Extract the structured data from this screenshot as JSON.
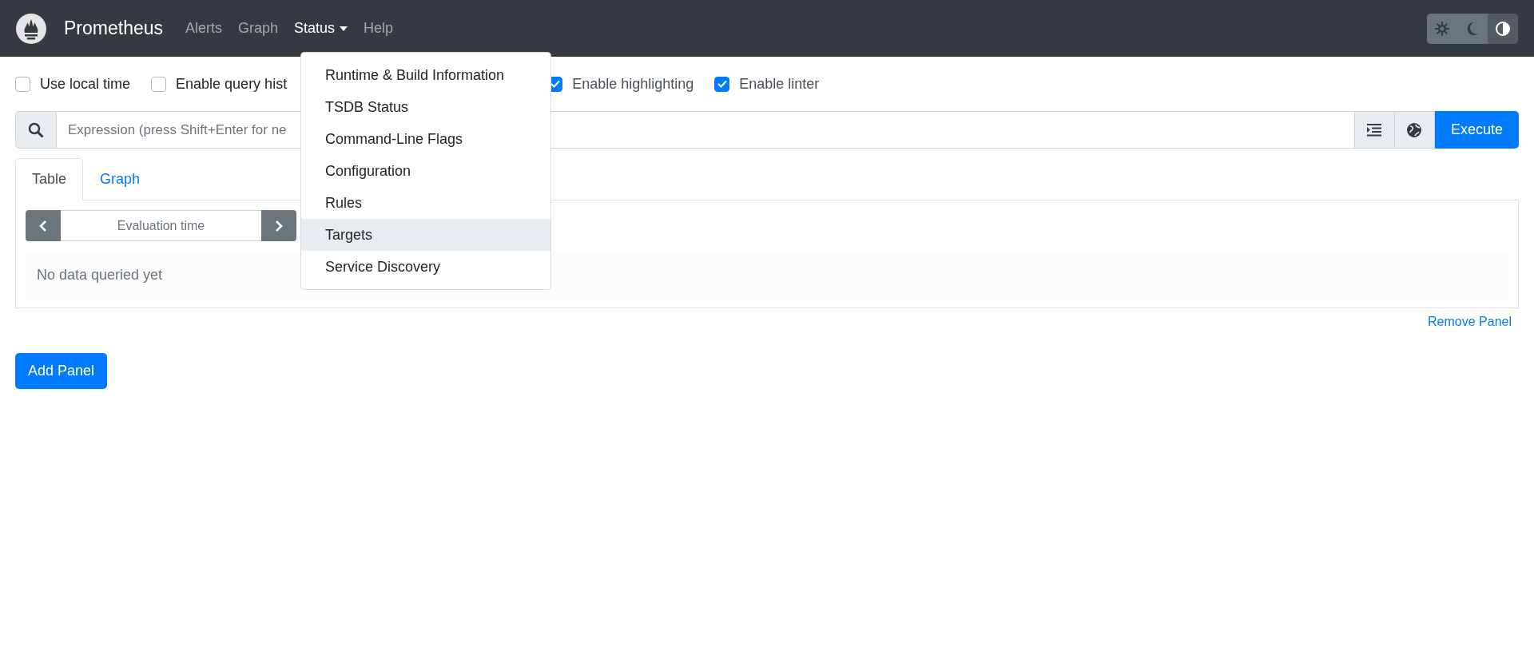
{
  "navbar": {
    "brand": "Prometheus",
    "links": [
      {
        "label": "Alerts",
        "active": false
      },
      {
        "label": "Graph",
        "active": false
      },
      {
        "label": "Status",
        "active": true,
        "kind": "dropdown"
      },
      {
        "label": "Help",
        "active": false
      }
    ],
    "theme_buttons": [
      {
        "kind": "light",
        "selected": false
      },
      {
        "kind": "dark",
        "selected": false
      },
      {
        "kind": "auto",
        "selected": true
      }
    ]
  },
  "options": [
    {
      "label": "Use local time",
      "checked": false
    },
    {
      "label": "Enable query hist",
      "checked": false
    },
    {
      "label": "Enable highlighting",
      "checked": true
    },
    {
      "label": "Enable linter",
      "checked": true
    }
  ],
  "expression": {
    "placeholder": "Expression (press Shift+Enter for ne",
    "execute": "Execute"
  },
  "panel": {
    "tabs": [
      {
        "label": "Table",
        "selected": true
      },
      {
        "label": "Graph",
        "selected": false
      }
    ],
    "evaluation_time": {
      "placeholder": "Evaluation time"
    },
    "message": "No data queried yet",
    "remove": "Remove Panel"
  },
  "add_panel": "Add Panel",
  "status_menu": [
    {
      "label": "Runtime & Build Information",
      "selected": false
    },
    {
      "label": "TSDB Status",
      "selected": false
    },
    {
      "label": "Command-Line Flags",
      "selected": false
    },
    {
      "label": "Configuration",
      "selected": false
    },
    {
      "label": "Rules",
      "selected": false
    },
    {
      "label": "Targets",
      "selected": true
    },
    {
      "label": "Service Discovery",
      "selected": false
    }
  ]
}
